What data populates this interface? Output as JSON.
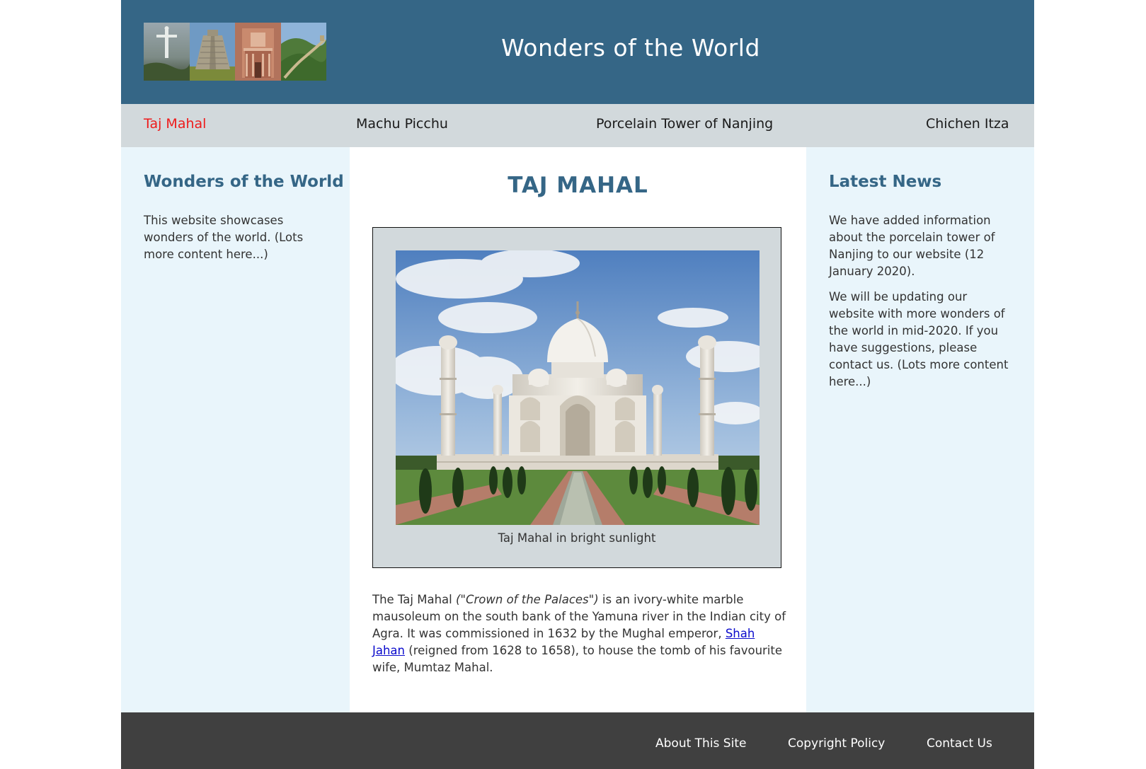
{
  "header": {
    "title": "Wonders of the World",
    "logo_tiles": [
      "christ-redeemer-photo",
      "chichen-itza-pyramid-photo",
      "petra-treasury-photo",
      "great-wall-photo"
    ]
  },
  "nav": {
    "items": [
      {
        "label": "Taj Mahal",
        "active": true
      },
      {
        "label": "Machu Picchu",
        "active": false
      },
      {
        "label": "Porcelain Tower of Nanjing",
        "active": false
      },
      {
        "label": "Chichen Itza",
        "active": false
      }
    ]
  },
  "left": {
    "heading": "Wonders of the World",
    "text": "This website showcases wonders of the world. (Lots more content here...)"
  },
  "main": {
    "heading": "TAJ MAHAL",
    "figure_caption": "Taj Mahal in bright sunlight",
    "para_start": "The Taj Mahal ",
    "para_italic": "(\"Crown of the Palaces\")",
    "para_mid": " is an ivory-white marble mausoleum on the south bank of the Yamuna river in the Indian city of Agra. It was commissioned in 1632 by the Mughal emperor, ",
    "para_link": "Shah Jahan",
    "para_end": " (reigned from 1628 to 1658), to house the tomb of his favourite wife, Mumtaz Mahal."
  },
  "right": {
    "heading": "Latest News",
    "news1": "We have added information about the porcelain tower of Nanjing to our website (12 January 2020).",
    "news2": "We will be updating our website with more wonders of the world in mid-2020. If you have suggestions, please contact us. (Lots more content here...)"
  },
  "footer": {
    "links": [
      "About This Site",
      "Copyright Policy",
      "Contact Us"
    ]
  },
  "colors": {
    "header_bg": "#356686",
    "nav_bg": "#d2d9dc",
    "sidebar_bg": "#e9f5fb",
    "footer_bg": "#404040",
    "active_nav": "#ee1b1b",
    "link": "#0b0bcc"
  }
}
